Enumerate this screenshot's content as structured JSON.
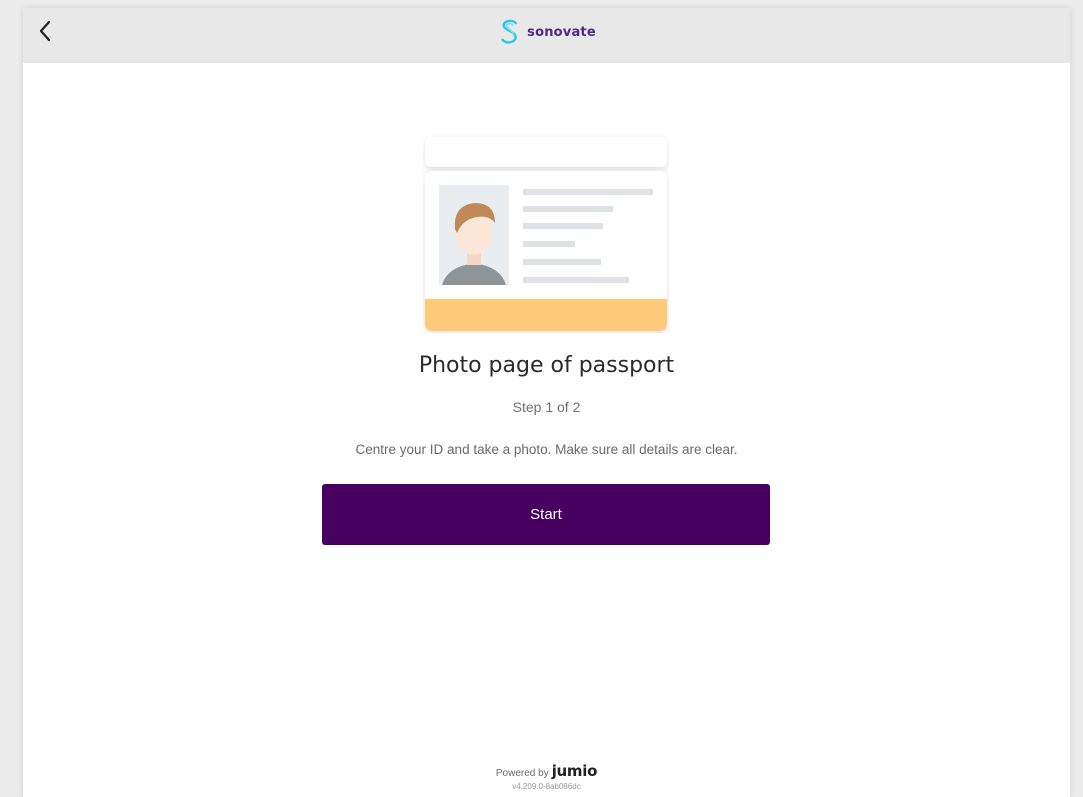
{
  "header": {
    "back_icon": "chevron-left-icon",
    "brand_name": "sonovate",
    "brand_logo_icon": "sonovate-s-logo-icon",
    "brand_color": "#4a2a8a",
    "logo_accent": "#29c6e6"
  },
  "main": {
    "illustration_icon": "id-card-passport-illustration",
    "document_title": "Photo page of passport",
    "step_text": "Step 1 of 2",
    "instruction": "Centre your ID and take a photo. Make sure all details are clear.",
    "start_label": "Start",
    "button_color": "#47005f",
    "card_accent": "#ffc97a"
  },
  "footer": {
    "powered_by": "Powered by",
    "provider": "jumio",
    "version": "v4.209.0-8ab086dc"
  }
}
